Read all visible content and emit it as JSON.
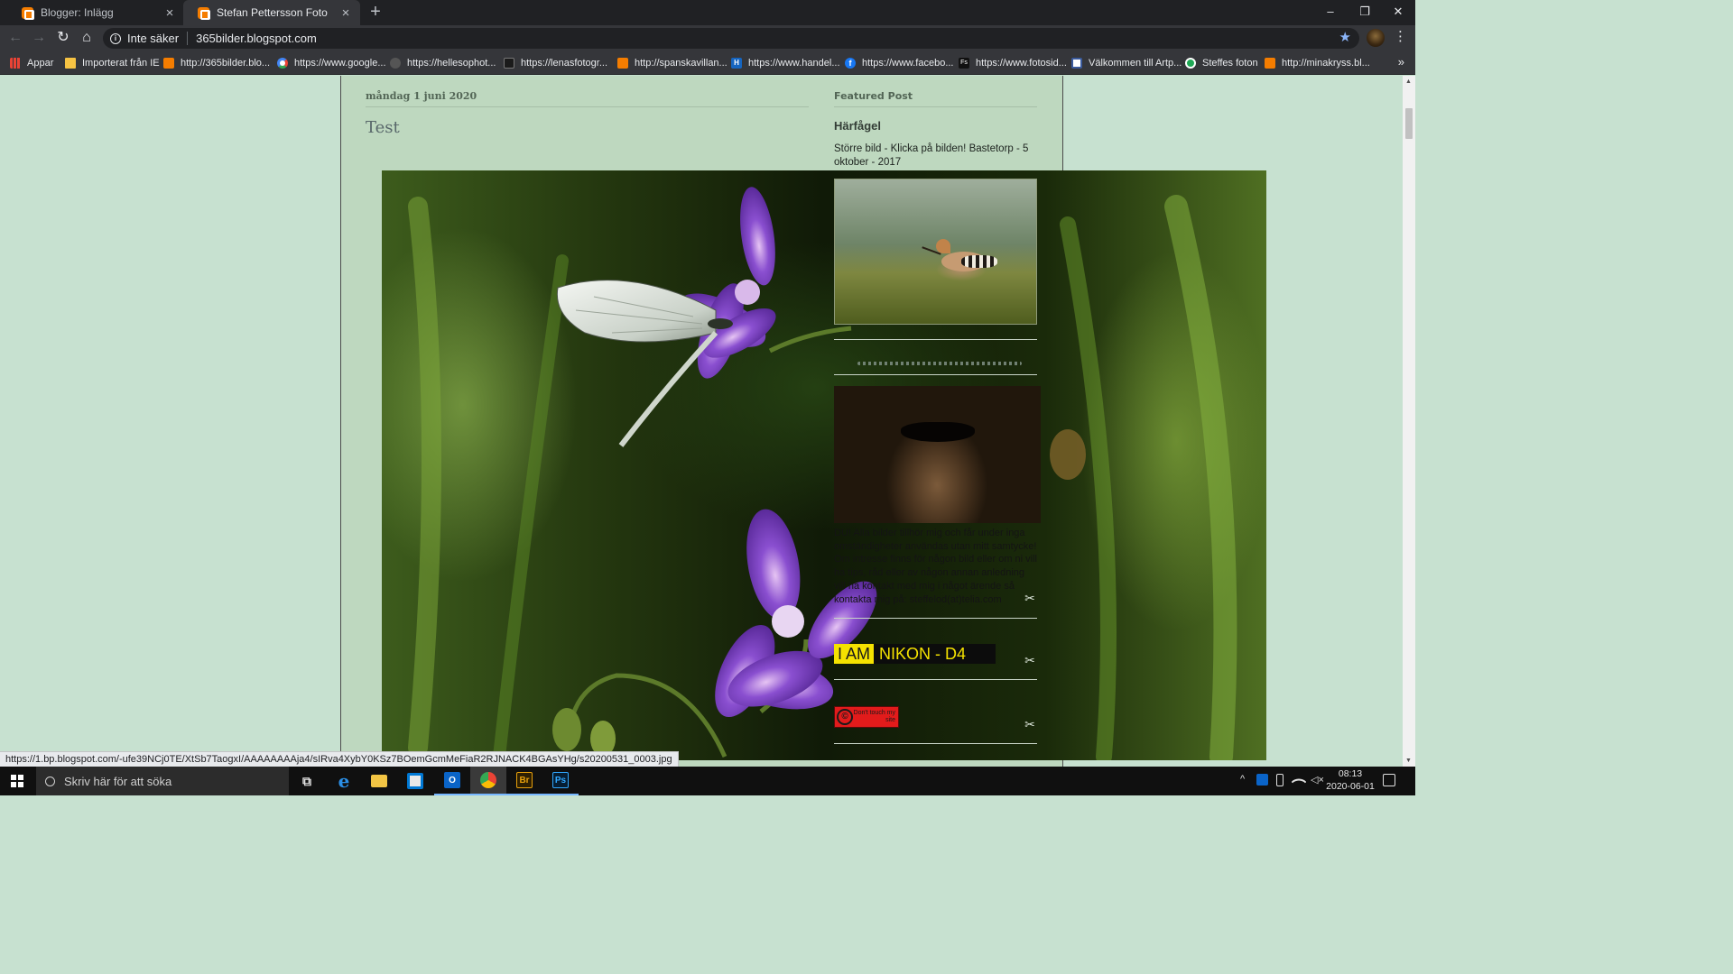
{
  "browser": {
    "tabs": [
      {
        "title": "Blogger: Inlägg",
        "close": "×"
      },
      {
        "title": "Stefan Pettersson Foto",
        "close": "×"
      }
    ],
    "new_tab": "+",
    "window_controls": {
      "minimize": "–",
      "restore": "❐",
      "close": "✕"
    },
    "nav": {
      "back": "←",
      "forward": "→",
      "reload": "↻",
      "home": "⌂"
    },
    "omnibox": {
      "security": "Inte säker",
      "url": "365bilder.blogspot.com",
      "star": "★"
    },
    "menu": "⋮",
    "bookmarks": [
      {
        "label": "Appar",
        "icon": "apps-grid-icon"
      },
      {
        "label": "Importerat från IE",
        "icon": "folder-icon"
      },
      {
        "label": "http://365bilder.blo...",
        "icon": "blogger-icon"
      },
      {
        "label": "https://www.google...",
        "icon": "google-icon"
      },
      {
        "label": "https://hellesophot...",
        "icon": "photo-icon"
      },
      {
        "label": "https://lenasfotogr...",
        "icon": "site-icon"
      },
      {
        "label": "http://spanskavillan...",
        "icon": "blogger-icon"
      },
      {
        "label": "https://www.handel...",
        "icon": "handelsbanken-icon"
      },
      {
        "label": "https://www.facebo...",
        "icon": "facebook-icon"
      },
      {
        "label": "https://www.fotosid...",
        "icon": "fotosidan-icon"
      },
      {
        "label": "Välkommen till Artp...",
        "icon": "page-icon"
      },
      {
        "label": "Steffes foton",
        "icon": "green-circle-icon"
      },
      {
        "label": "http://minakryss.bl...",
        "icon": "blogger-icon"
      }
    ],
    "bookmarks_more": "»",
    "status_url": "https://1.bp.blogspot.com/-ufe39NCj0TE/XtSb7TaogxI/AAAAAAAAja4/sIRva4XybY0KSz7BOemGcmMeFiaR2RJNACK4BGAsYHg/s20200531_0003.jpg"
  },
  "blog": {
    "date_header": "måndag 1 juni 2020",
    "post_title": "Test",
    "sidebar": {
      "featured_heading": "Featured Post",
      "featured_title": "Härfågel",
      "featured_text": "Större bild - Klicka på bilden! Bastetorp - 5 oktober - 2017",
      "about_text": "DU! Alla bilder tillhör mig och får under inga omständigheter användas utan mitt samtycke! Om intresse finns för någon bild eller om ni vill ha tips, råd eller av någon annan anledning vill ha kontakt med mig i något ärende så kontakta mig på: steffelod(at)telia.com",
      "nikon_badge": {
        "prefix": "I AM",
        "model": "NIKON - D4"
      },
      "dont_touch": {
        "symbol": "©",
        "text": "Don't touch my site"
      },
      "edit_icon": "✂"
    }
  },
  "taskbar": {
    "search_placeholder": "Skriv här för att söka",
    "apps": [
      {
        "name": "task-view",
        "label": "⧉"
      },
      {
        "name": "edge",
        "label": "e"
      },
      {
        "name": "file-explorer",
        "label": ""
      },
      {
        "name": "store",
        "label": ""
      },
      {
        "name": "outlook",
        "label": "O"
      },
      {
        "name": "chrome",
        "label": ""
      },
      {
        "name": "bridge",
        "label": "Br"
      },
      {
        "name": "photoshop",
        "label": "Ps"
      }
    ],
    "tray": {
      "chevron": "^",
      "time": "08:13",
      "date": "2020-06-01"
    }
  },
  "colors": {
    "page_bg": "#c7e1d0",
    "blog_col_bg": "#bed8bf",
    "tab_bar": "#202124",
    "toolbar": "#35363a",
    "blogger_orange": "#f57d00",
    "nikon_yellow": "#f5e200",
    "dont_touch_red": "#e21b1b"
  }
}
